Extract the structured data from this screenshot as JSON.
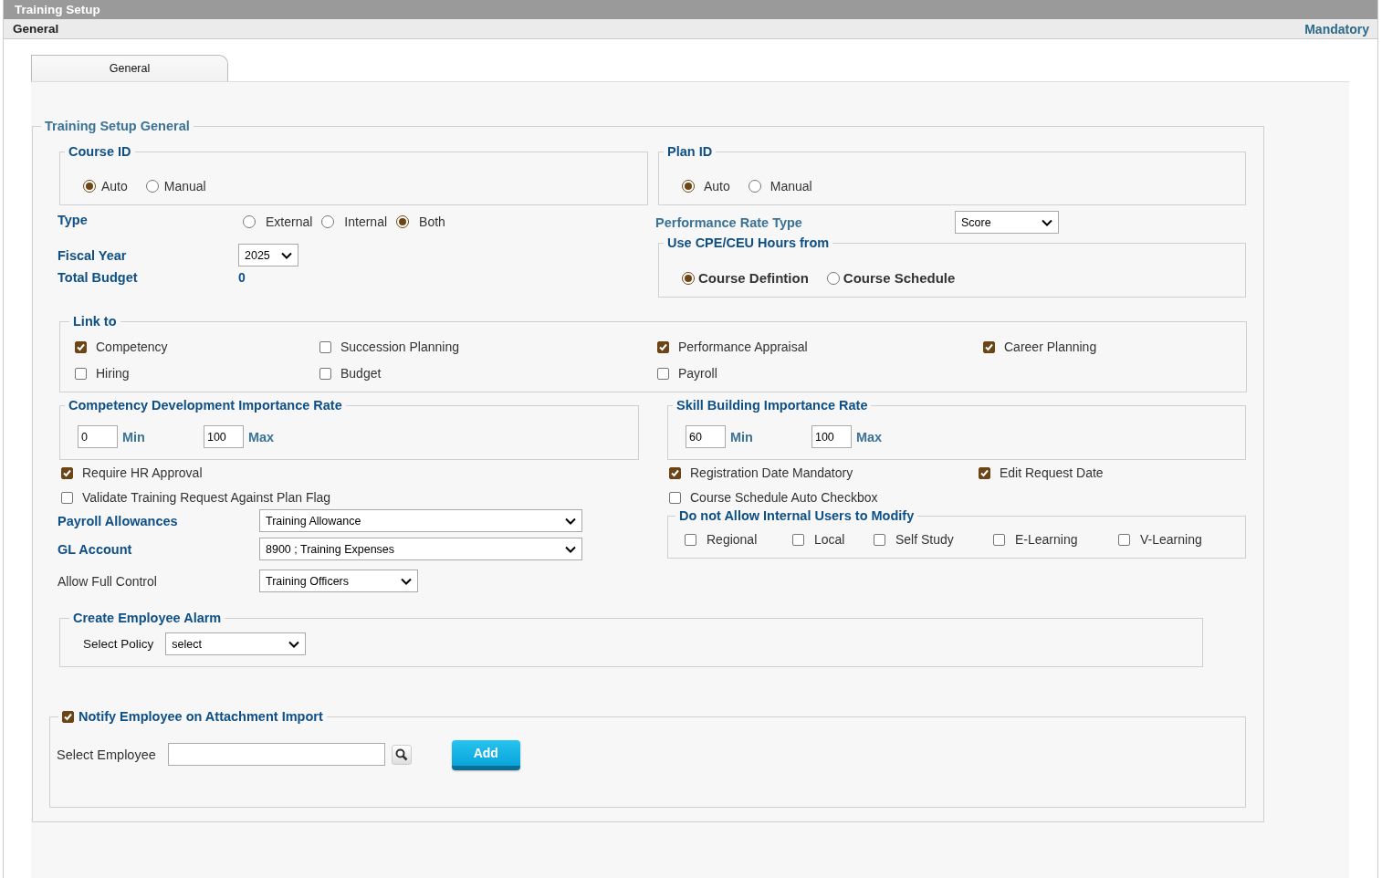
{
  "header": {
    "title": "Training Setup"
  },
  "subheader": {
    "title": "General",
    "mandatory": "Mandatory"
  },
  "tabs": [
    {
      "label": "General",
      "selected": true
    }
  ],
  "section": {
    "title": "Training Setup General"
  },
  "course_id": {
    "title": "Course ID",
    "options": [
      {
        "label": "Auto",
        "selected": true
      },
      {
        "label": "Manual",
        "selected": false
      }
    ]
  },
  "plan_id": {
    "title": "Plan ID",
    "options": [
      {
        "label": "Auto",
        "selected": true
      },
      {
        "label": "Manual",
        "selected": false
      }
    ]
  },
  "type": {
    "label": "Type",
    "options": [
      {
        "label": "External",
        "selected": false
      },
      {
        "label": "Internal",
        "selected": false
      },
      {
        "label": "Both",
        "selected": true
      }
    ]
  },
  "performance_rate_type": {
    "label": "Performance Rate Type",
    "value": "Score"
  },
  "fiscal_year": {
    "label": "Fiscal Year",
    "value": "2025"
  },
  "total_budget": {
    "label": "Total Budget",
    "value": "0"
  },
  "cpe_hours": {
    "title": "Use CPE/CEU Hours from",
    "options": [
      {
        "label": "Course Defintion",
        "selected": true
      },
      {
        "label": "Course Schedule",
        "selected": false
      }
    ]
  },
  "link_to": {
    "title": "Link to",
    "items": [
      {
        "label": "Competency",
        "checked": true
      },
      {
        "label": "Succession Planning",
        "checked": false
      },
      {
        "label": "Performance Appraisal",
        "checked": true
      },
      {
        "label": "Career Planning",
        "checked": true
      },
      {
        "label": "Hiring",
        "checked": false
      },
      {
        "label": "Budget",
        "checked": false
      },
      {
        "label": "Payroll",
        "checked": false
      }
    ]
  },
  "competency_rate": {
    "title": "Competency Development Importance Rate",
    "min": "0",
    "min_label": "Min",
    "max": "100",
    "max_label": "Max"
  },
  "skill_rate": {
    "title": "Skill Building Importance Rate",
    "min": "60",
    "min_label": "Min",
    "max": "100",
    "max_label": "Max"
  },
  "options_left": [
    {
      "label": "Require HR Approval",
      "checked": true
    },
    {
      "label": "Validate Training Request Against Plan Flag",
      "checked": false
    }
  ],
  "options_right": [
    {
      "label": "Registration Date Mandatory",
      "checked": true
    },
    {
      "label": "Edit Request Date",
      "checked": true
    },
    {
      "label": "Course Schedule Auto Checkbox",
      "checked": false
    }
  ],
  "payroll_allowances": {
    "label": "Payroll Allowances",
    "value": "Training Allowance"
  },
  "gl_account": {
    "label": "GL Account",
    "value": "8900 ; Training Expenses"
  },
  "allow_full_control": {
    "label": "Allow Full Control",
    "value": "Training Officers"
  },
  "internal_users": {
    "title": "Do not Allow Internal Users to Modify",
    "items": [
      {
        "label": "Regional",
        "checked": false
      },
      {
        "label": "Local",
        "checked": false
      },
      {
        "label": "Self Study",
        "checked": false
      },
      {
        "label": "E-Learning",
        "checked": false
      },
      {
        "label": "V-Learning",
        "checked": false
      }
    ]
  },
  "employee_alarm": {
    "title": "Create Employee Alarm",
    "policy_label": "Select Policy",
    "policy_value": "select"
  },
  "notify": {
    "title": "Notify Employee on Attachment Import",
    "checked": true,
    "employee_label": "Select Employee",
    "add_button": "Add"
  }
}
